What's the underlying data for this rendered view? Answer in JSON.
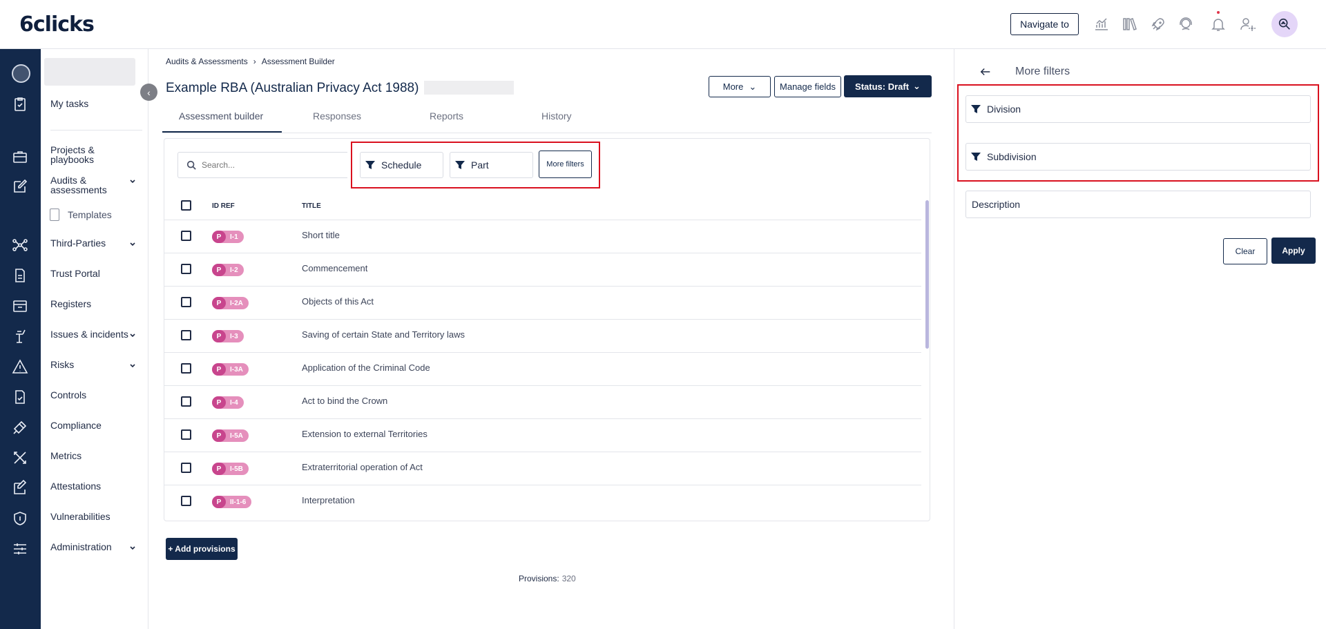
{
  "header": {
    "logo": "6clicks",
    "navigate_label": "Navigate to"
  },
  "sidebar": {
    "items": [
      {
        "label": "My tasks",
        "chevron": false
      },
      {
        "label": "Projects & playbooks",
        "chevron": false
      },
      {
        "label": "Audits & assessments",
        "chevron": true
      },
      {
        "label": "Third-Parties",
        "chevron": true
      },
      {
        "label": "Trust Portal",
        "chevron": false
      },
      {
        "label": "Registers",
        "chevron": false
      },
      {
        "label": "Issues & incidents",
        "chevron": true
      },
      {
        "label": "Risks",
        "chevron": true
      },
      {
        "label": "Controls",
        "chevron": false
      },
      {
        "label": "Compliance",
        "chevron": false
      },
      {
        "label": "Metrics",
        "chevron": false
      },
      {
        "label": "Attestations",
        "chevron": false
      },
      {
        "label": "Vulnerabilities",
        "chevron": false
      },
      {
        "label": "Administration",
        "chevron": true
      }
    ],
    "sub_item": "Templates"
  },
  "breadcrumb": [
    "Audits & Assessments",
    "Assessment Builder"
  ],
  "page": {
    "title": "Example RBA (Australian Privacy Act 1988)",
    "more_label": "More",
    "manage_label": "Manage fields",
    "status_label": "Status: Draft"
  },
  "tabs": [
    "Assessment builder",
    "Responses",
    "Reports",
    "History"
  ],
  "filters": {
    "search_placeholder": "Search...",
    "schedule_label": "Schedule",
    "part_label": "Part",
    "more_filters_label": "More filters"
  },
  "table": {
    "columns": [
      "ID REF",
      "TITLE"
    ],
    "rows": [
      {
        "type": "P",
        "id": "I-1",
        "title": "Short title"
      },
      {
        "type": "P",
        "id": "I-2",
        "title": "Commencement"
      },
      {
        "type": "P",
        "id": "I-2A",
        "title": "Objects of this Act"
      },
      {
        "type": "P",
        "id": "I-3",
        "title": "Saving of certain State and Territory laws"
      },
      {
        "type": "P",
        "id": "I-3A",
        "title": "Application of the Criminal Code"
      },
      {
        "type": "P",
        "id": "I-4",
        "title": "Act to bind the Crown"
      },
      {
        "type": "P",
        "id": "I-5A",
        "title": "Extension to external Territories"
      },
      {
        "type": "P",
        "id": "I-5B",
        "title": "Extraterritorial operation of Act"
      },
      {
        "type": "P",
        "id": "II-1-6",
        "title": "Interpretation"
      }
    ]
  },
  "footer": {
    "add_label": "+ Add provisions",
    "provisions_label": "Provisions:",
    "provisions_count": "320"
  },
  "panel": {
    "title": "More filters",
    "fields": [
      "Division",
      "Subdivision"
    ],
    "description_label": "Description",
    "clear_label": "Clear",
    "apply_label": "Apply"
  },
  "colors": {
    "navy": "#13294b",
    "highlight": "#d9101e",
    "badge_pink": "#e58fbc",
    "badge_magenta": "#c8458d",
    "avatar_bg": "#e4d6f8"
  }
}
